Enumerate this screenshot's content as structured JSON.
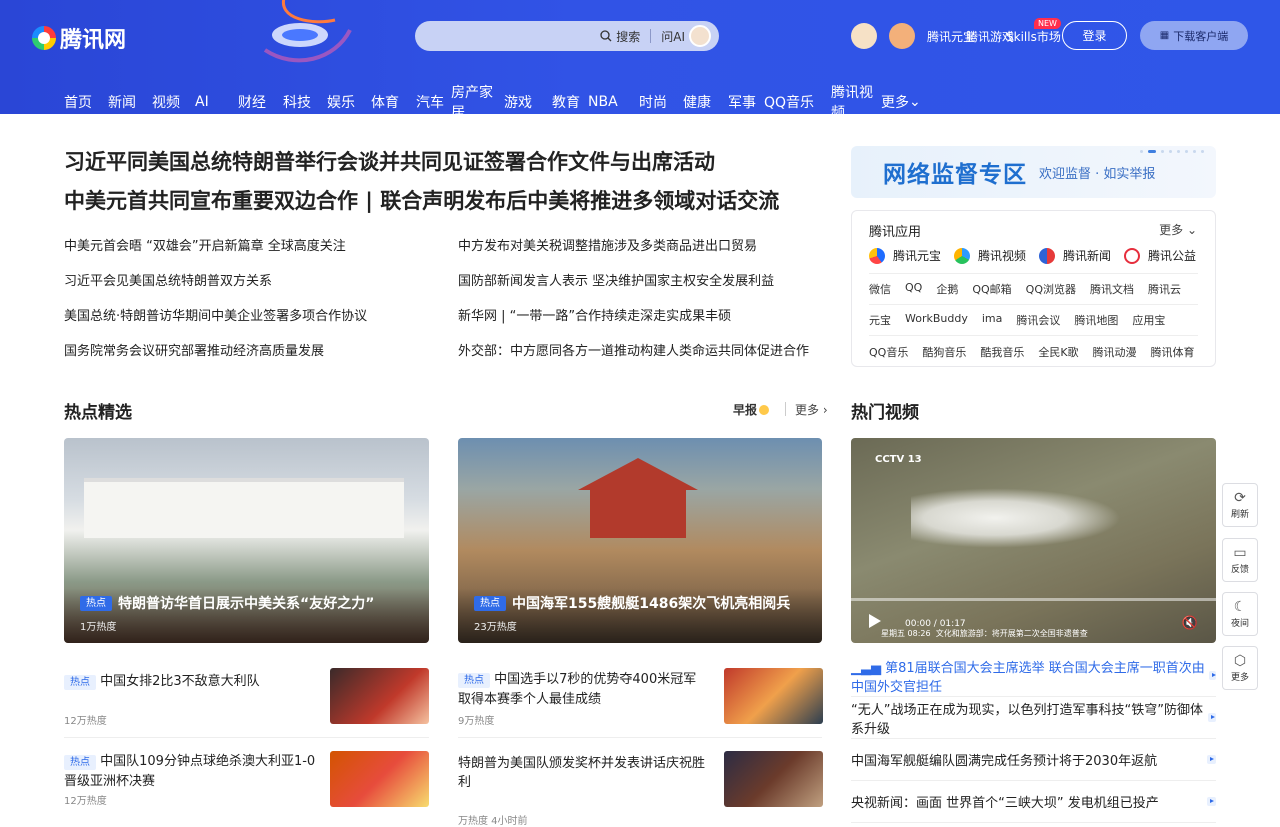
{
  "header": {
    "logo_text": "腾讯网",
    "search_button": "搜索",
    "ai_button": "问AI",
    "links": [
      "腾讯元宝",
      "腾讯游戏",
      "Skills市场"
    ],
    "new_badge": "NEW",
    "login": "登录",
    "client": "下载客户端"
  },
  "nav": [
    "首页",
    "新闻",
    "视频",
    "AI",
    "财经",
    "科技",
    "娱乐",
    "体育",
    "汽车",
    "房产家居",
    "游戏",
    "教育",
    "NBA",
    "时尚",
    "健康",
    "军事",
    "QQ音乐",
    "腾讯视频",
    "更多"
  ],
  "headline": {
    "line1": "习近平同美国总统特朗普举行会谈并共同见证签署合作文件与出席活动",
    "line2": "中美元首共同宣布重要双边合作 | 联合声明发布后中美将推进多领域对话交流"
  },
  "news_left": [
    "中美元首会晤  “双雄会”开启新篇章  全球高度关注",
    "习近平会见美国总统特朗普双方关系",
    "美国总统·特朗普访华期间中美企业签署多项合作协议",
    "国务院常务会议研究部署推动经济高质量发展"
  ],
  "news_right": [
    "中方发布对美关税调整措施涉及多类商品进出口贸易",
    "国防部新闻发言人表示 坚决维护国家主权安全发展利益",
    "新华网 | “一带一路”合作持续走深走实成果丰硕",
    "外交部：中方愿同各方一道推动构建人类命运共同体促进合作"
  ],
  "ad": {
    "title": "网络监督专区",
    "subtitle": "欢迎监督 · 如实举报"
  },
  "apps": {
    "title": "腾讯应用",
    "more": "更多",
    "featured": [
      "腾讯元宝",
      "腾讯视频",
      "腾讯新闻",
      "腾讯公益"
    ],
    "row2": [
      "微信",
      "QQ",
      "企鹅",
      "QQ邮箱",
      "QQ浏览器",
      "腾讯文档",
      "腾讯云"
    ],
    "row3": [
      "元宝",
      "WorkBuddy",
      "ima",
      "腾讯会议",
      "腾讯地图",
      "应用宝"
    ],
    "row4": [
      "QQ音乐",
      "酷狗音乐",
      "酷我音乐",
      "全民K歌",
      "腾讯动漫",
      "腾讯体育"
    ]
  },
  "sections": {
    "hot": "热点精选",
    "hot_tag1": "早报",
    "hot_more": "更多",
    "video": "热门视频"
  },
  "cards": [
    {
      "tag": "热点",
      "title": "特朗普访华首日展示中美关系“友好之力”",
      "views": "1万热度"
    },
    {
      "tag": "热点",
      "title": "中国海军155艘舰艇1486架次飞机亮相阅兵",
      "views": "23万热度"
    }
  ],
  "items": [
    {
      "tag": "热点",
      "title": "中国女排2比3不敌意大利队",
      "views": "12万热度"
    },
    {
      "tag": "热点",
      "title": "中国选手以7秒的优势夺400米冠军 取得本赛季个人最佳成绩",
      "views": "9万热度"
    },
    {
      "tag": "热点",
      "title": "中国队109分钟点球绝杀澳大利亚1-0晋级亚洲杯决赛",
      "views": "12万热度"
    },
    {
      "tag": "",
      "title": "特朗普为美国队颁发奖杯并发表讲话庆祝胜利",
      "views": "万热度 4小时前"
    }
  ],
  "video": {
    "time": "00:00",
    "duration": "01:17",
    "channel": "CCTV 13",
    "ticker": "文化和旅游部：将开展第二次全国非遗普查",
    "date": "星期五",
    "clock": "08:26"
  },
  "video_list": [
    "第81届联合国大会主席选举 联合国大会主席一职首次由中国外交官担任",
    "“无人”战场正在成为现实，以色列打造军事科技“铁穹”防御体系升级",
    "中国海军舰艇编队圆满完成任务预计将于2030年返航",
    "央视新闻：画面 世界首个“三峡大坝” 发电机组已投产"
  ],
  "side_tools": [
    "刷新",
    "反馈",
    "夜间",
    "更多"
  ]
}
